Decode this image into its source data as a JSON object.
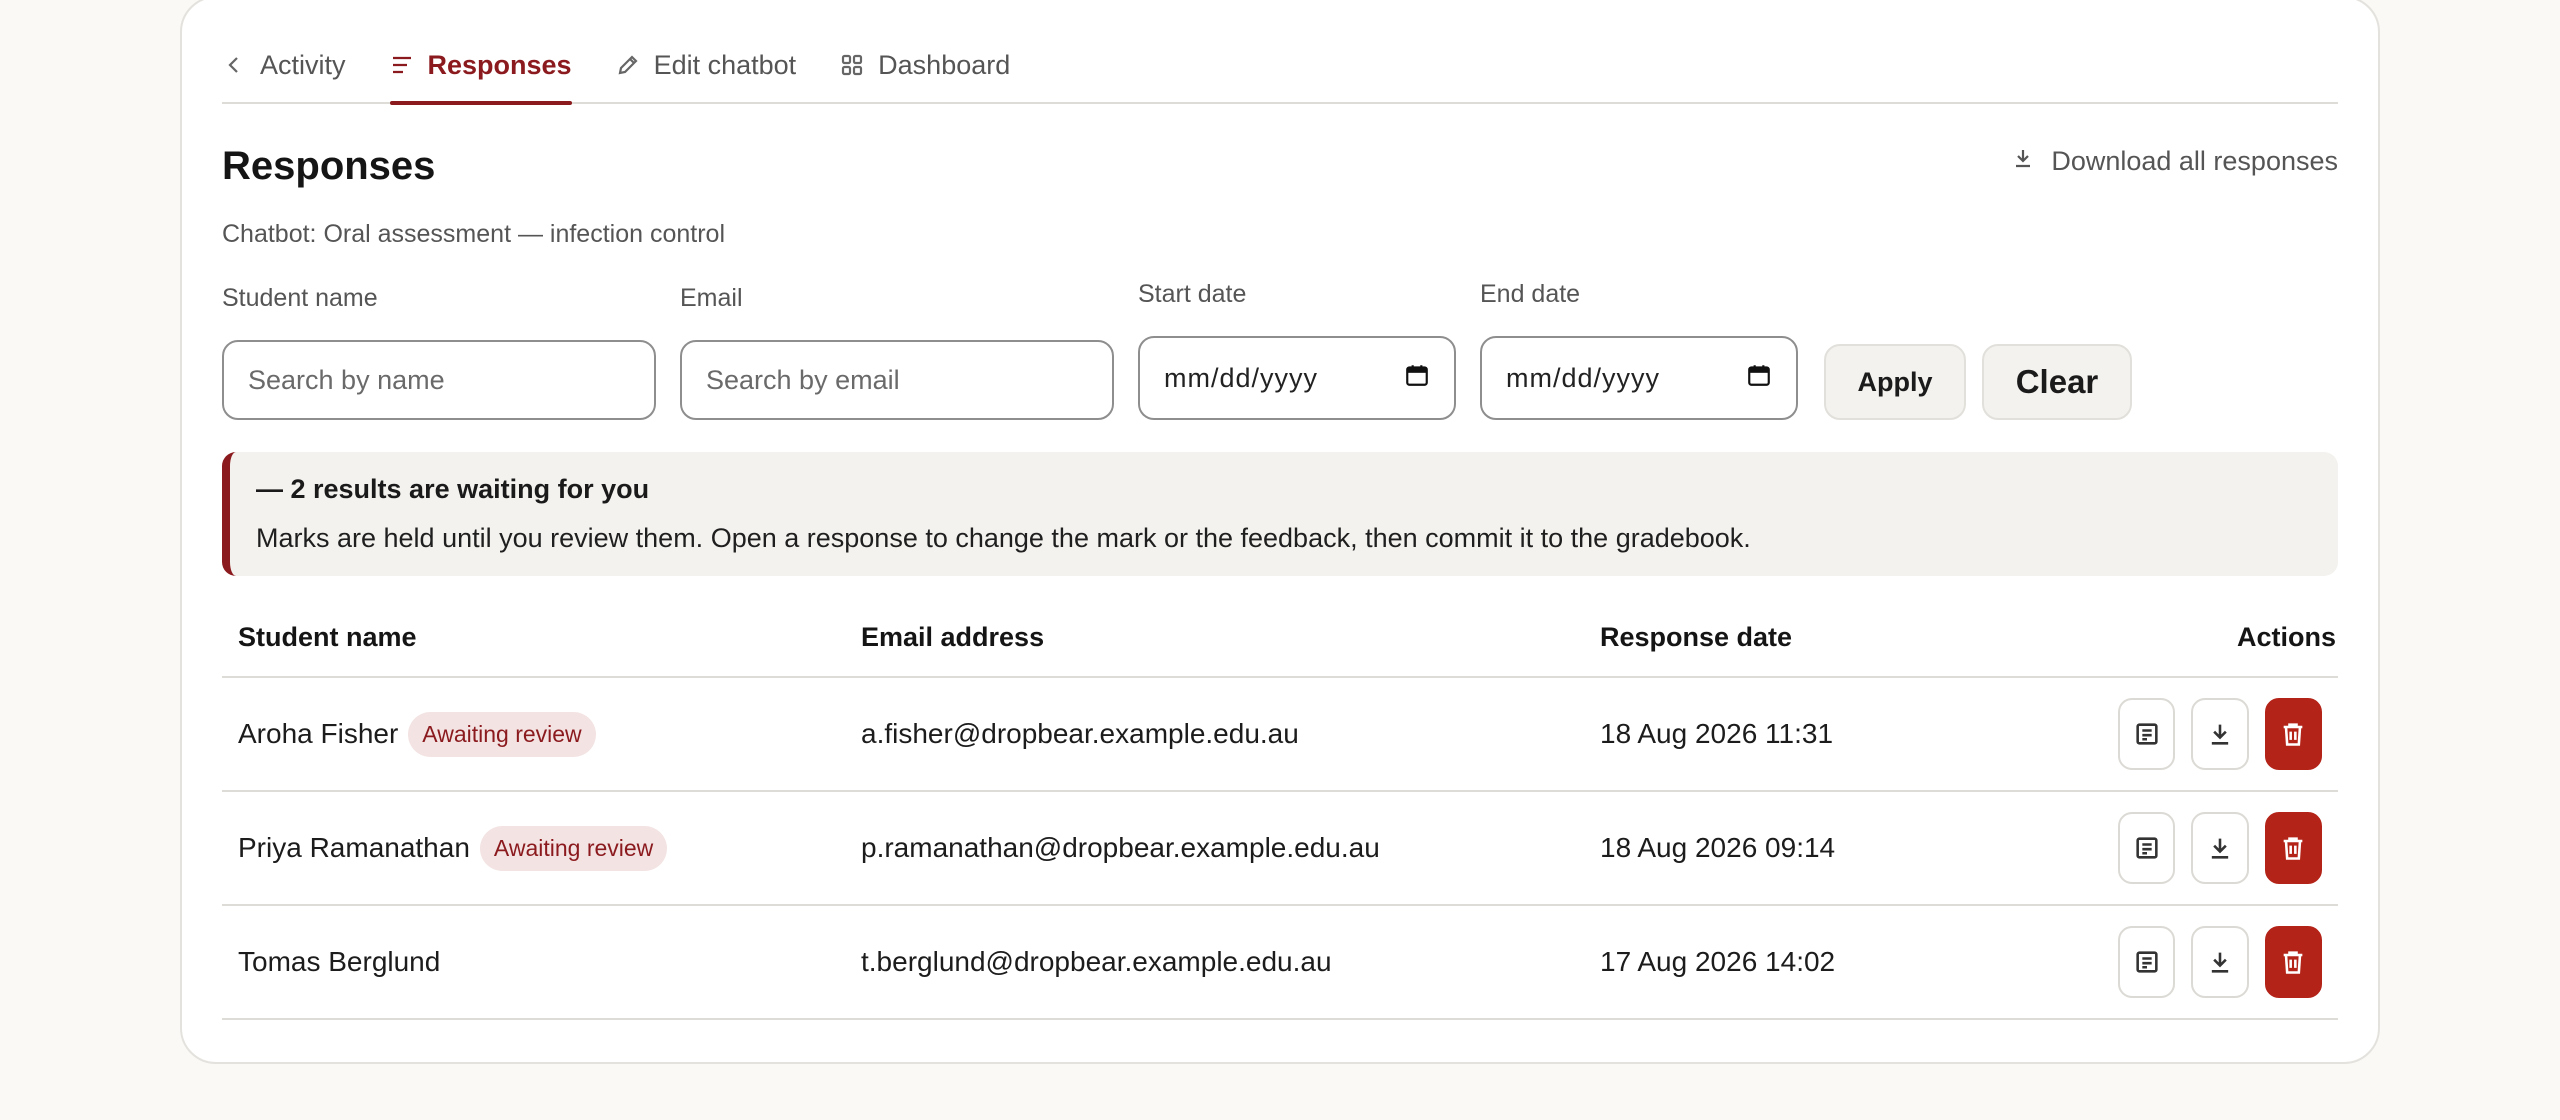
{
  "tabs": [
    {
      "label": "Activity",
      "icon": "chevron-left-icon"
    },
    {
      "label": "Responses",
      "icon": "lines-icon",
      "active": true
    },
    {
      "label": "Edit chatbot",
      "icon": "pencil-icon"
    },
    {
      "label": "Dashboard",
      "icon": "grid-icon"
    }
  ],
  "page": {
    "title": "Responses",
    "download_all": "Download all responses",
    "subtitle": "Chatbot: Oral assessment — infection control"
  },
  "filters": {
    "name_label": "Student name",
    "name_placeholder": "Search by name",
    "email_label": "Email",
    "email_placeholder": "Search by email",
    "start_label": "Start date",
    "start_value": "mm/dd/yyyy",
    "end_label": "End date",
    "end_value": "mm/dd/yyyy",
    "apply": "Apply",
    "clear": "Clear"
  },
  "notice": {
    "title": "— 2 results are waiting for you",
    "body": "Marks are held until you review them. Open a response to change the mark or the feedback, then commit it to the gradebook."
  },
  "table": {
    "headers": {
      "name": "Student name",
      "email": "Email address",
      "date": "Response date",
      "actions": "Actions"
    },
    "rows": [
      {
        "name": "Aroha Fisher",
        "badge": "Awaiting review",
        "email": "a.fisher@dropbear.example.edu.au",
        "date": "18 Aug 2026 11:31"
      },
      {
        "name": "Priya Ramanathan",
        "badge": "Awaiting review",
        "email": "p.ramanathan@dropbear.example.edu.au",
        "date": "18 Aug 2026 09:14"
      },
      {
        "name": "Tomas Berglund",
        "badge": "",
        "email": "t.berglund@dropbear.example.edu.au",
        "date": "17 Aug 2026 14:02"
      }
    ]
  },
  "colors": {
    "accent": "#8b1a1e",
    "danger": "#b42318",
    "badge_bg": "#f3e3e3",
    "panel_bg": "#f3f2ee"
  }
}
